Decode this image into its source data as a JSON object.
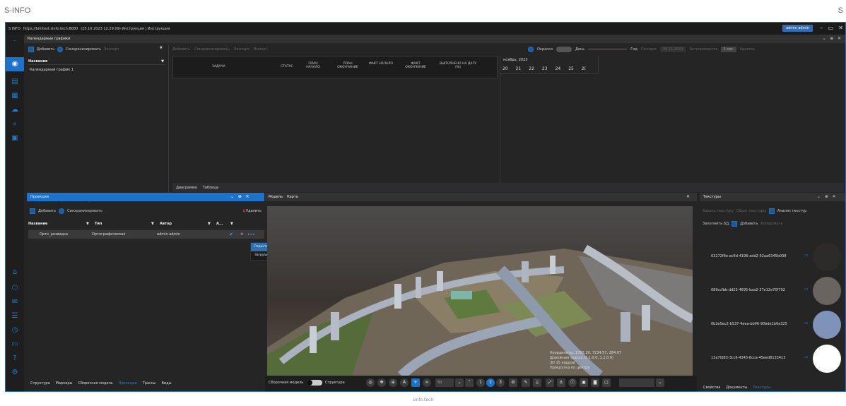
{
  "page": {
    "top_left_caption": "S-INFO",
    "top_right_caption": "S",
    "bottom_caption": "sinfo.tech"
  },
  "titlebar": {
    "app": "S  INFO",
    "url": "https://bimtest.sinfo.tech:8080",
    "info": "(25.10.2023 12:29:09) Инструкция | Инструкция",
    "user": "admin admin",
    "min": "–",
    "max": "▭",
    "close": "✕"
  },
  "calendar": {
    "title": "Календарные графики",
    "add": "Добавить",
    "sync": "Синхронизировать",
    "export": "Экспорт",
    "list_header": "Название",
    "items": [
      "Календарный график 1"
    ],
    "toolbar": {
      "add": "Добавить",
      "sync": "Синхронизировать",
      "export": "Экспорт",
      "import": "Импорт",
      "coloring": "Окраска",
      "day": "День",
      "year": "Год",
      "today": "Сегодня",
      "date": "25.11.2023",
      "autoscroll": "Автопрокрутка",
      "sec": "1 сек.",
      "delete": "Удалить"
    },
    "columns": [
      "ЗАДАЧА",
      "СТАТУС",
      "ПЛАН НАЧАЛО",
      "ПЛАН ОКОНЧАНИЕ",
      "ФАКТ НАЧАЛО",
      "ФАКТ ОКОНЧАНИЕ",
      "ВЫПОЛНЕНО НА ДАТУ (%)"
    ],
    "month": "ноябрь, 2023",
    "days": [
      "20",
      "21",
      "22",
      "23",
      "24",
      "25",
      "2("
    ],
    "view_tabs": [
      "Диаграмма",
      "Таблица"
    ],
    "bottom_tabs": [
      "Календарные графики",
      "Таблицы"
    ]
  },
  "projections": {
    "title": "Проекции",
    "add": "Добавить",
    "sync": "Синхронизировать",
    "delete": "Удалить",
    "columns": [
      "Название",
      "Тип",
      "Автор",
      "А..."
    ],
    "row": {
      "name": "Орто_разводка",
      "type": "Ортографическая",
      "author": "admin admin",
      "more": "•••"
    },
    "menu": [
      "Редактировать",
      "Загрузить исходный файл"
    ],
    "bottom_tabs": [
      "Структура",
      "Маркеры",
      "Сборочная модель",
      "Проекции",
      "Трассы",
      "Виды"
    ]
  },
  "model": {
    "tabs": [
      "Модель",
      "Карта"
    ],
    "overlay": [
      "Координаты: 1782.20, 7234.57, 284.07",
      "Дорожная трасса (1.1.0.0, 1.1.0.0)",
      "3D 15 кадров",
      "Прокрутка по центру"
    ],
    "bottom": {
      "assembly": "Сборочная модель",
      "structure": "Структура",
      "value": "50",
      "pages": [
        "1",
        "2",
        "3"
      ]
    }
  },
  "textures": {
    "title": "Текстуры",
    "set": "Задать текстуру",
    "reset": "Сброс текстуры",
    "analyze": "Анализ текстур",
    "fill_db": "Заполнить БД",
    "add": "Добавить",
    "copy": "Копировать",
    "items": [
      {
        "id": "03272f8e-ac6d-4196-add2-52aa6345b008",
        "color": "#2d2b29"
      },
      {
        "id": "089ccfbb-dd23-4695-baa2-37e12e70f792",
        "color": "#6a6461"
      },
      {
        "id": "0b2e5ec2-b537-4aea-bb96-90bde1b0a325",
        "color": "#7f93b8"
      },
      {
        "id": "13a7fd83-3cc6-4343-8cca-45eed8133413",
        "color": "#ffffff"
      }
    ],
    "bottom_tabs": [
      "Свойства",
      "Документы",
      "Текстуры"
    ]
  }
}
